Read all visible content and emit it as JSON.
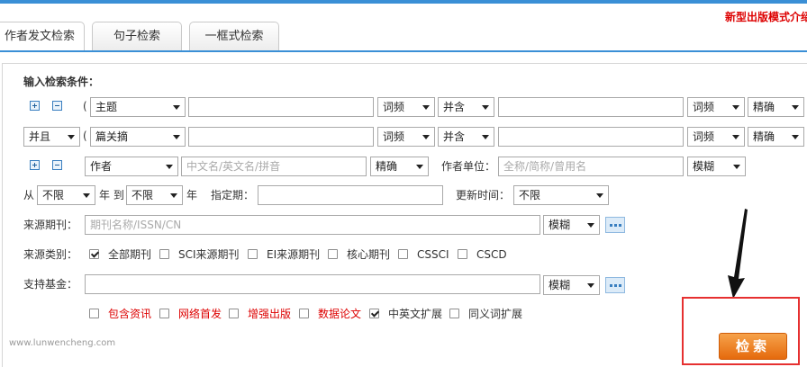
{
  "promo": "新型出版模式介绍",
  "tabs": [
    {
      "label": "作者发文检索",
      "active": true
    },
    {
      "label": "句子检索",
      "active": false
    },
    {
      "label": "一框式检索",
      "active": false
    }
  ],
  "form": {
    "heading": "输入检索条件：",
    "row1": {
      "paren": "(",
      "field": "主题",
      "freq1": "词频",
      "logic": "并含",
      "freq2": "词频",
      "match": "精确"
    },
    "row2": {
      "bool": "并且",
      "paren": "(",
      "field": "篇关摘",
      "freq1": "词频",
      "logic": "并含",
      "freq2": "词频",
      "match": "精确"
    },
    "row3": {
      "field": "作者",
      "author_placeholder": "中文名/英文名/拼音",
      "match": "精确",
      "org_label": "作者单位：",
      "org_placeholder": "全称/简称/曾用名",
      "org_match": "模糊"
    },
    "row4": {
      "from": "从",
      "start": "不限",
      "year_to": "年 到",
      "end": "不限",
      "year": "年",
      "date_label": "指定期：",
      "update_label": "更新时间：",
      "update": "不限"
    },
    "journal": {
      "label": "来源期刊：",
      "placeholder": "期刊名称/ISSN/CN",
      "match": "模糊"
    },
    "category": {
      "label": "来源类别：",
      "options": [
        {
          "label": "全部期刊",
          "checked": true
        },
        {
          "label": "SCI来源期刊",
          "checked": false
        },
        {
          "label": "EI来源期刊",
          "checked": false
        },
        {
          "label": "核心期刊",
          "checked": false
        },
        {
          "label": "CSSCI",
          "checked": false
        },
        {
          "label": "CSCD",
          "checked": false
        }
      ]
    },
    "fund": {
      "label": "支持基金：",
      "match": "模糊"
    },
    "extra": [
      {
        "label": "包含资讯",
        "checked": false,
        "red": true
      },
      {
        "label": "网络首发",
        "checked": false,
        "red": true
      },
      {
        "label": "增强出版",
        "checked": false,
        "red": true
      },
      {
        "label": "数据论文",
        "checked": false,
        "red": true
      },
      {
        "label": "中英文扩展",
        "checked": true,
        "red": false
      },
      {
        "label": "同义词扩展",
        "checked": false,
        "red": false
      }
    ]
  },
  "watermark": "www.lunwencheng.com",
  "search_button": "检索"
}
